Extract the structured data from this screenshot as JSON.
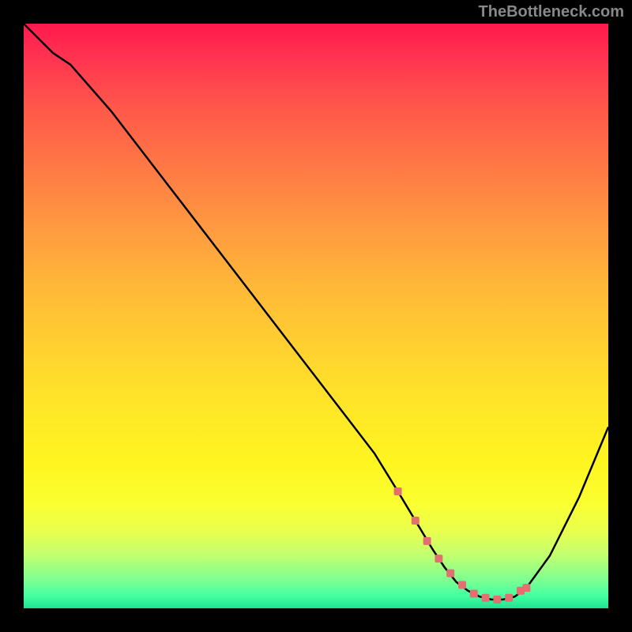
{
  "watermark": "TheBottleneck.com",
  "chart_data": {
    "type": "line",
    "title": "",
    "xlabel": "",
    "ylabel": "",
    "xlim": [
      0,
      100
    ],
    "ylim": [
      0,
      100
    ],
    "series": [
      {
        "name": "bottleneck-curve",
        "x": [
          0,
          5,
          8,
          15,
          25,
          35,
          45,
          55,
          60,
          64,
          67,
          70,
          72,
          74,
          76,
          78,
          80,
          82,
          84,
          86,
          90,
          95,
          100
        ],
        "values": [
          100,
          95,
          93,
          85,
          72,
          59,
          46,
          33,
          26.5,
          20,
          15,
          10,
          7,
          4.5,
          3,
          2,
          1.5,
          1.5,
          2,
          3.5,
          9,
          19,
          31
        ]
      }
    ],
    "markers": {
      "name": "highlight-band",
      "x": [
        64,
        67,
        69,
        71,
        73,
        75,
        77,
        79,
        81,
        83,
        85,
        86
      ],
      "values": [
        20,
        15,
        11.5,
        8.5,
        6,
        4,
        2.5,
        1.8,
        1.5,
        1.8,
        3,
        3.5
      ]
    },
    "colors": {
      "gradient_top": "#ff1a4d",
      "gradient_mid": "#ffd030",
      "gradient_bottom": "#20e090",
      "curve": "#000000",
      "marker": "#e27070"
    }
  }
}
